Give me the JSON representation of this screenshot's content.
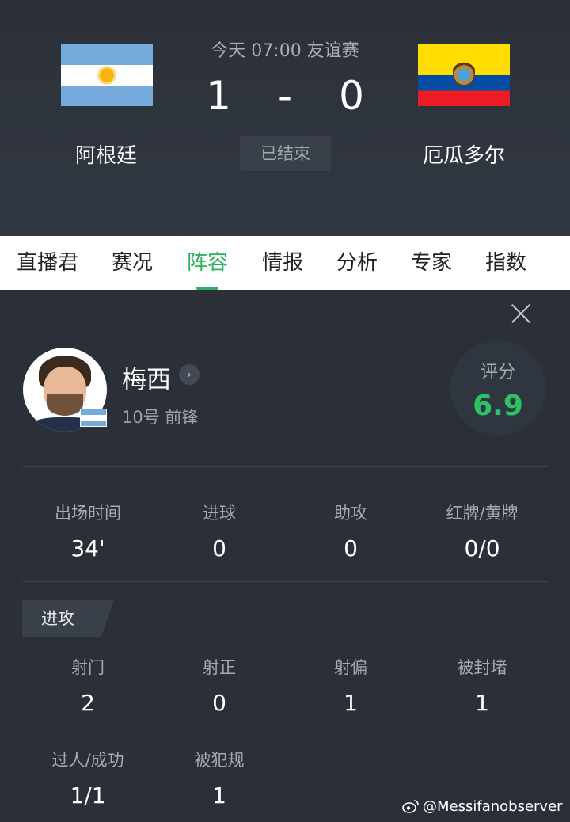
{
  "match": {
    "meta": "今天 07:00 友谊赛",
    "home_team": "阿根廷",
    "away_team": "厄瓜多尔",
    "home_score": "1",
    "separator": "-",
    "away_score": "0",
    "status": "已结束"
  },
  "tabs": [
    {
      "label": "直播君",
      "active": false
    },
    {
      "label": "赛况",
      "active": false
    },
    {
      "label": "阵容",
      "active": true
    },
    {
      "label": "情报",
      "active": false
    },
    {
      "label": "分析",
      "active": false
    },
    {
      "label": "专家",
      "active": false
    },
    {
      "label": "指数",
      "active": false
    }
  ],
  "player": {
    "name": "梅西",
    "info": "10号 前锋",
    "rating_label": "评分",
    "rating": "6.9"
  },
  "summary_stats": [
    {
      "label": "出场时间",
      "value": "34'"
    },
    {
      "label": "进球",
      "value": "0"
    },
    {
      "label": "助攻",
      "value": "0"
    },
    {
      "label": "红牌/黄牌",
      "value": "0/0"
    }
  ],
  "attack": {
    "title": "进攻",
    "stats": [
      {
        "label": "射门",
        "value": "2"
      },
      {
        "label": "射正",
        "value": "0"
      },
      {
        "label": "射偏",
        "value": "1"
      },
      {
        "label": "被封堵",
        "value": "1"
      },
      {
        "label": "过人/成功",
        "value": "1/1"
      },
      {
        "label": "被犯规",
        "value": "1"
      }
    ]
  },
  "watermark": "@Messifanobserver",
  "colors": {
    "accent": "#2bb15c",
    "rating": "#2bc364",
    "background": "#2a2f38"
  }
}
